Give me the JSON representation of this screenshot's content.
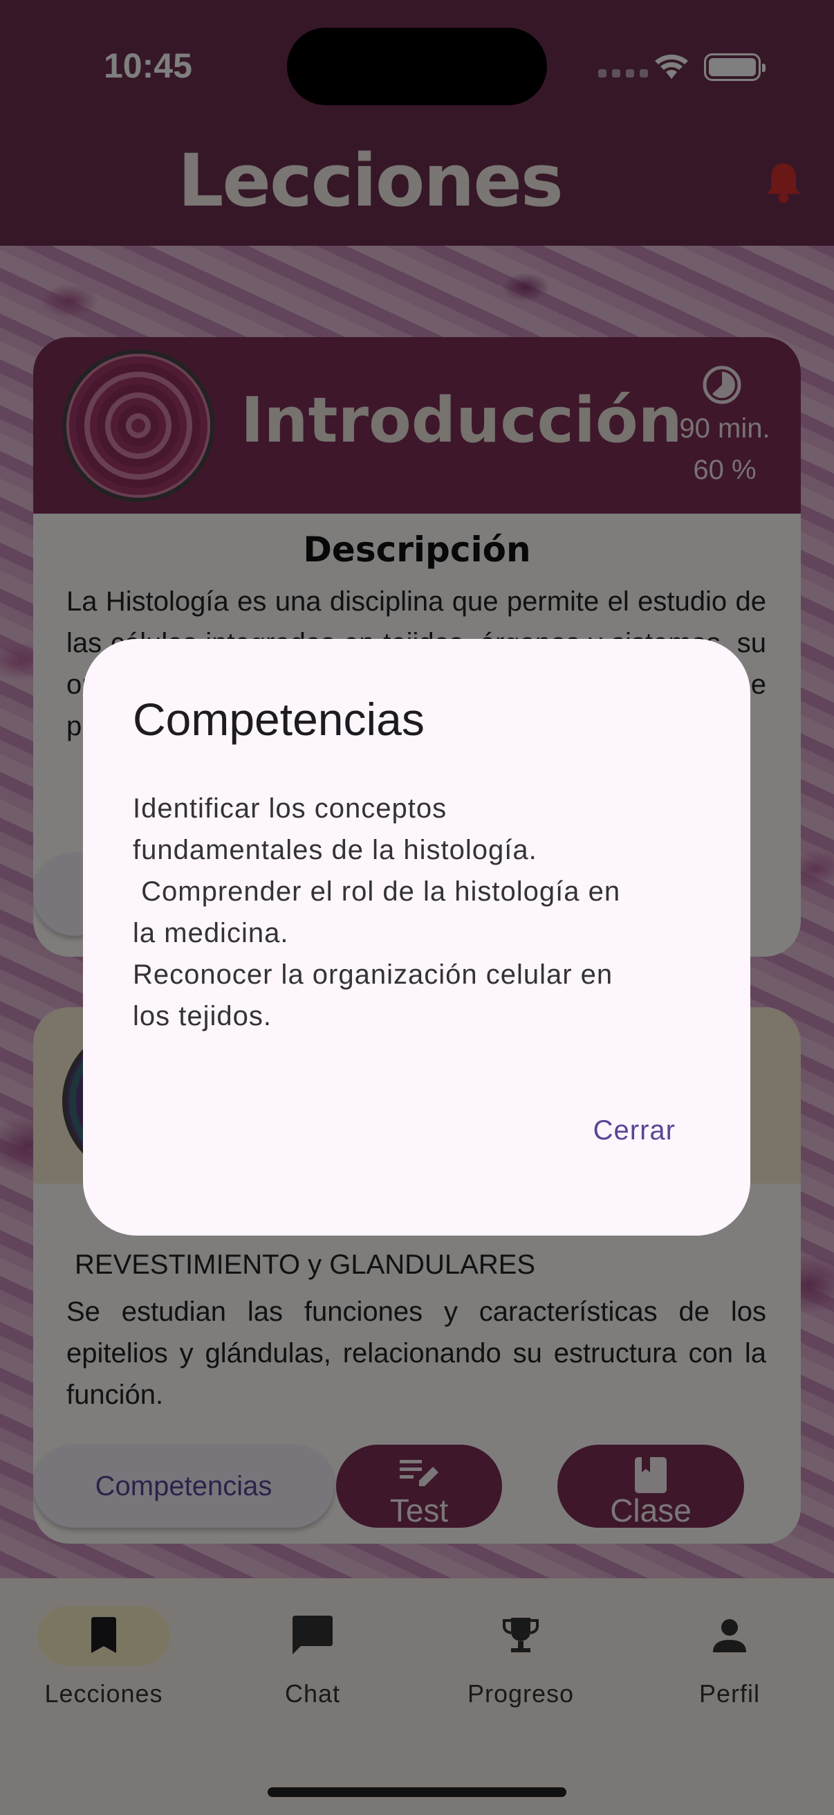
{
  "status_bar": {
    "time": "10:45"
  },
  "header": {
    "title": "Lecciones"
  },
  "lessons": [
    {
      "title": "Introducción",
      "duration": "90 min.",
      "progress": "60 %",
      "desc_title": "Descripción",
      "description": "La Histología es una disciplina que permite el estudio de las células integradas en tejidos, órganos y sistemas, su organización y función en el organismo, y sirve de base para las ciencias médicas"
    },
    {
      "subtitle": "REVESTIMIENTO y GLANDULARES",
      "description": "Se estudian las funciones y características de los epitelios y glándulas, relacionando su estructura con la función.",
      "buttons": {
        "competencias": "Competencias",
        "test": "Test",
        "clase": "Clase"
      }
    }
  ],
  "dialog": {
    "title": "Competencias",
    "body": "Identificar los conceptos\nfundamentales de la histología.\n Comprender el rol de la histología en\nla medicina.\nReconocer la organización celular en\nlos tejidos.",
    "close_label": "Cerrar"
  },
  "bottom_nav": {
    "items": [
      {
        "label": "Lecciones",
        "icon": "bookmark-icon",
        "active": true
      },
      {
        "label": "Chat",
        "icon": "chat-icon",
        "active": false
      },
      {
        "label": "Progreso",
        "icon": "trophy-icon",
        "active": false
      },
      {
        "label": "Perfil",
        "icon": "person-icon",
        "active": false
      }
    ]
  },
  "colors": {
    "primary": "#7c2f56",
    "header": "#6d2f4e",
    "accent_text": "#5b4494",
    "alert": "#d32f2f",
    "nav_active_pill": "#f5ecc4"
  }
}
